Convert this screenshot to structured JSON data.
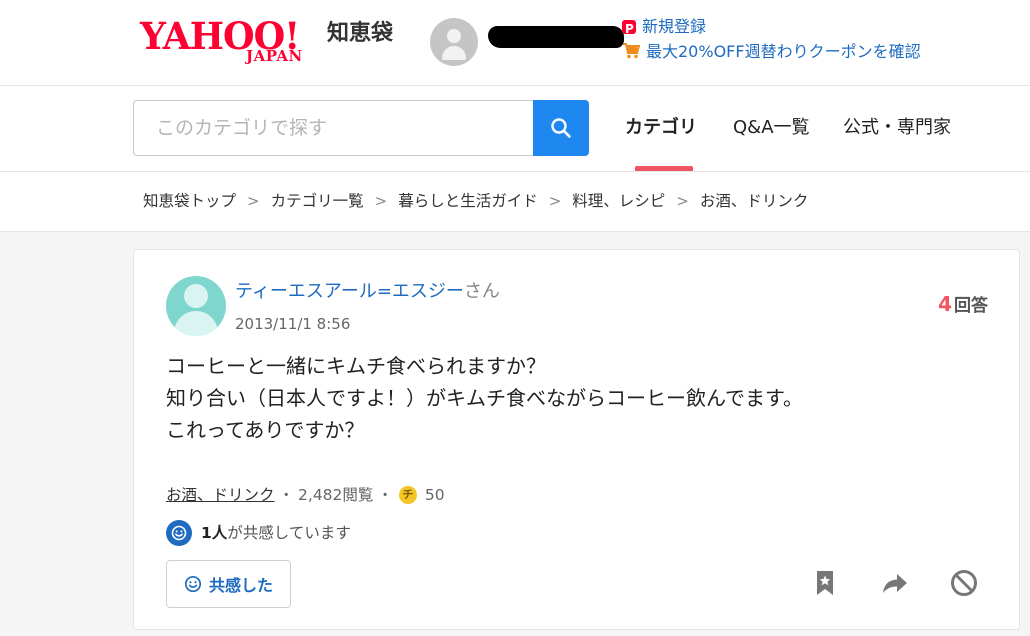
{
  "header": {
    "logo_main": "YAHOO!",
    "logo_sub": "JAPAN",
    "service_name": "知恵袋",
    "promo_register": "新規登録",
    "promo_coupon": "最大20%OFF週替わりクーポンを確認",
    "paypay_icon": "paypay-icon",
    "cart_icon": "shopping-cart-icon"
  },
  "search": {
    "placeholder": "このカテゴリで探す",
    "button_icon": "search-icon"
  },
  "nav": {
    "tabs": [
      {
        "label": "カテゴリ",
        "active": true
      },
      {
        "label": "Q&A一覧",
        "active": false
      },
      {
        "label": "公式・専門家",
        "active": false
      }
    ],
    "indicator_color": "#ef5562"
  },
  "breadcrumb": {
    "items": [
      "知恵袋トップ",
      "カテゴリ一覧",
      "暮らしと生活ガイド",
      "料理、レシピ",
      "お酒、ドリンク"
    ],
    "separator": ">"
  },
  "question": {
    "user_name": "ティーエスアール=エスジー",
    "user_suffix": "さん",
    "date": "2013/11/1 8:56",
    "answer_count": "4",
    "answer_label": "回答",
    "body": [
      "コーヒーと一緒にキムチ食べられますか？",
      "知り合い（日本人ですよ！）がキムチ食べながらコーヒー飲んでます。",
      "これってありですか？"
    ],
    "category": "お酒、ドリンク",
    "views": "2,482閲覧",
    "meta_separator": "・",
    "coin_symbol": "チ",
    "coins": "50",
    "empathy_count": "1人",
    "empathy_text": "が共感しています",
    "empathy_button": "共感した"
  },
  "colors": {
    "link_blue": "#1e6bc0",
    "search_blue": "#1e87f0",
    "accent_red": "#ef5562",
    "yahoo_red": "#ff0033",
    "avatar_teal": "#7fd6cf"
  }
}
